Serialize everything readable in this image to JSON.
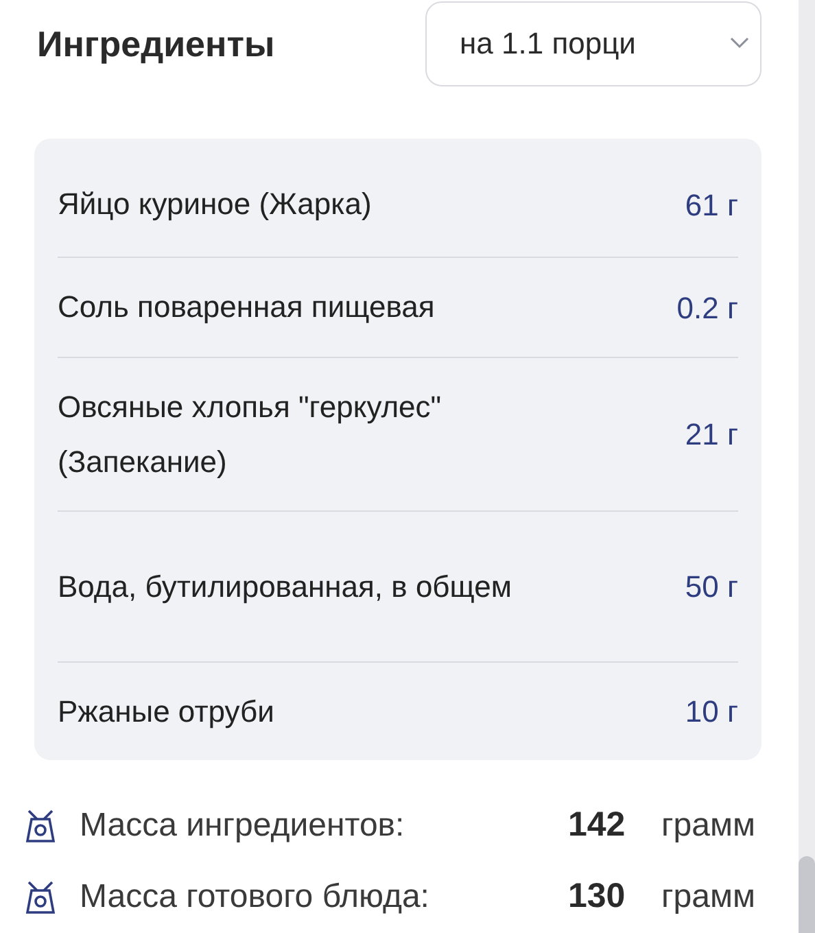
{
  "header": {
    "title": "Ингредиенты",
    "portion_select": {
      "value": "на 1.1 порци"
    }
  },
  "ingredients": [
    {
      "name": "Яйцо куриное (Жарка)",
      "amount": "61 г"
    },
    {
      "name": "Соль поваренная пищевая",
      "amount": "0.2 г"
    },
    {
      "name": "Овсяные хлопья \"геркулес\" (Запекание)",
      "amount": "21 г"
    },
    {
      "name": "Вода, бутилированная, в общем",
      "amount": "50 г"
    },
    {
      "name": "Ржаные отруби",
      "amount": "10 г"
    }
  ],
  "summary": [
    {
      "label": "Масса ингредиентов:",
      "value": "142",
      "unit": "грамм"
    },
    {
      "label": "Масса готового блюда:",
      "value": "130",
      "unit": "грамм"
    }
  ]
}
